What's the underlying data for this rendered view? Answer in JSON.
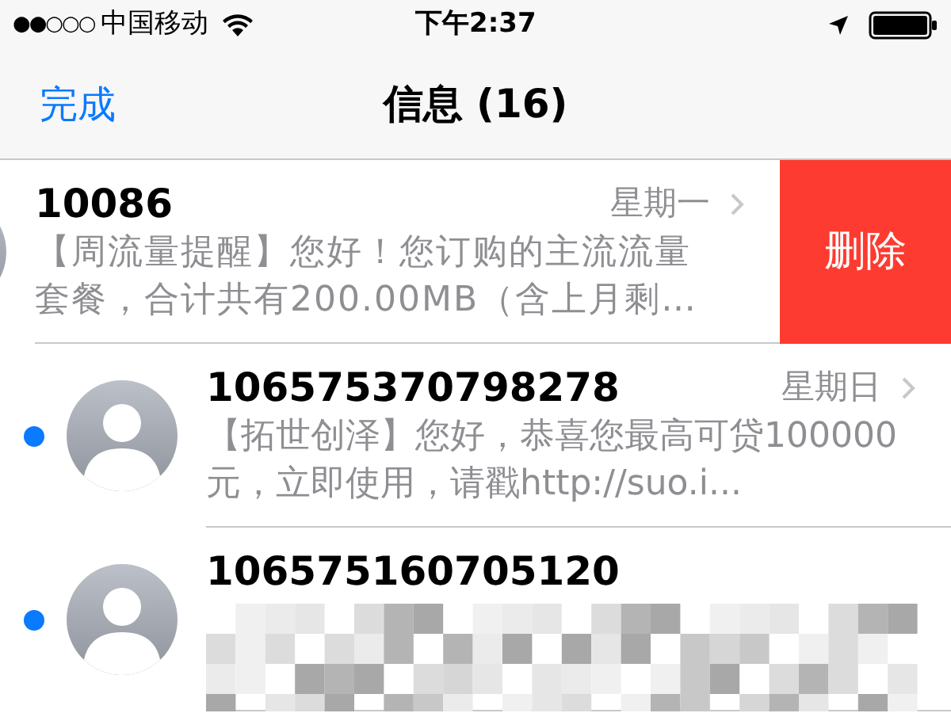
{
  "status_bar": {
    "signal": "●●○○○",
    "carrier": "中国移动",
    "time": "下午2:37"
  },
  "nav": {
    "done": "完成",
    "title": "信息 (16)"
  },
  "messages": [
    {
      "sender": "10086",
      "day": "星期一",
      "preview": "【周流量提醒】您好！您订购的主流流量套餐，合计共有200.00MB（含上月剩…",
      "unread": false,
      "swiped": true,
      "action": "删除",
      "obscured": false
    },
    {
      "sender": "106575370798278",
      "day": "星期日",
      "preview": "【拓世创泽】您好，恭喜您最高可贷100000元，立即使用，请戳http://suo.i...",
      "unread": true,
      "swiped": false,
      "obscured": false
    },
    {
      "sender": "106575160705120",
      "unread": true,
      "swiped": false,
      "obscured": true
    }
  ]
}
